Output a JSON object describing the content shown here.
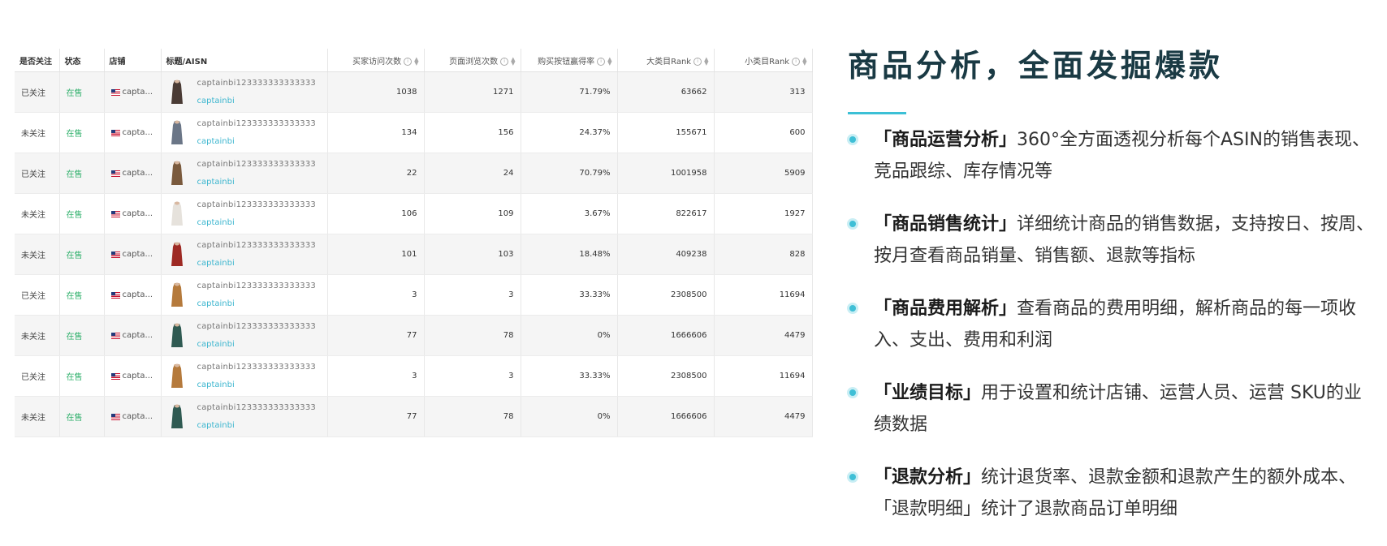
{
  "table": {
    "columns": {
      "follow": "是否关注",
      "status": "状态",
      "store": "店铺",
      "title": "标题/AISN",
      "buyer_visits": "买家访问次数",
      "page_views": "页面浏览次数",
      "buybox_rate": "购买按钮赢得率",
      "main_rank": "大类目Rank",
      "sub_rank": "小类目Rank"
    },
    "rows": [
      {
        "follow": "已关注",
        "status": "在售",
        "store": "capta...",
        "title": "captainbi123333333333333",
        "asin": "captainbi",
        "buyer_visits": "1038",
        "page_views": "1271",
        "buybox_rate": "71.79%",
        "main_rank": "63662",
        "sub_rank": "313",
        "thumb_color": "#4a3b35"
      },
      {
        "follow": "未关注",
        "status": "在售",
        "store": "capta...",
        "title": "captainbi123333333333333",
        "asin": "captainbi",
        "buyer_visits": "134",
        "page_views": "156",
        "buybox_rate": "24.37%",
        "main_rank": "155671",
        "sub_rank": "600",
        "thumb_color": "#6b7687"
      },
      {
        "follow": "已关注",
        "status": "在售",
        "store": "capta...",
        "title": "captainbi123333333333333",
        "asin": "captainbi",
        "buyer_visits": "22",
        "page_views": "24",
        "buybox_rate": "70.79%",
        "main_rank": "1001958",
        "sub_rank": "5909",
        "thumb_color": "#7a5a3d"
      },
      {
        "follow": "未关注",
        "status": "在售",
        "store": "capta...",
        "title": "captainbi123333333333333",
        "asin": "captainbi",
        "buyer_visits": "106",
        "page_views": "109",
        "buybox_rate": "3.67%",
        "main_rank": "822617",
        "sub_rank": "1927",
        "thumb_color": "#e6e2dc"
      },
      {
        "follow": "未关注",
        "status": "在售",
        "store": "capta...",
        "title": "captainbi123333333333333",
        "asin": "captainbi",
        "buyer_visits": "101",
        "page_views": "103",
        "buybox_rate": "18.48%",
        "main_rank": "409238",
        "sub_rank": "828",
        "thumb_color": "#9e2a24"
      },
      {
        "follow": "已关注",
        "status": "在售",
        "store": "capta...",
        "title": "captainbi123333333333333",
        "asin": "captainbi",
        "buyer_visits": "3",
        "page_views": "3",
        "buybox_rate": "33.33%",
        "main_rank": "2308500",
        "sub_rank": "11694",
        "thumb_color": "#b57a3c"
      },
      {
        "follow": "未关注",
        "status": "在售",
        "store": "capta...",
        "title": "captainbi123333333333333",
        "asin": "captainbi",
        "buyer_visits": "77",
        "page_views": "78",
        "buybox_rate": "0%",
        "main_rank": "1666606",
        "sub_rank": "4479",
        "thumb_color": "#2f5a52"
      },
      {
        "follow": "已关注",
        "status": "在售",
        "store": "capta...",
        "title": "captainbi123333333333333",
        "asin": "captainbi",
        "buyer_visits": "3",
        "page_views": "3",
        "buybox_rate": "33.33%",
        "main_rank": "2308500",
        "sub_rank": "11694",
        "thumb_color": "#b57a3c"
      },
      {
        "follow": "未关注",
        "status": "在售",
        "store": "capta...",
        "title": "captainbi123333333333333",
        "asin": "captainbi",
        "buyer_visits": "77",
        "page_views": "78",
        "buybox_rate": "0%",
        "main_rank": "1666606",
        "sub_rank": "4479",
        "thumb_color": "#2f5a52"
      }
    ]
  },
  "panel": {
    "heading": "商品分析，全面发掘爆款",
    "accent_color": "#3cc0d6",
    "features": [
      {
        "name": "「商品运营分析」",
        "desc": "360°全方面透视分析每个ASIN的销售表现、竞品跟综、库存情况等"
      },
      {
        "name": "「商品销售统计」",
        "desc": "详细统计商品的销售数据，支持按日、按周、按月查看商品销量、销售额、退款等指标"
      },
      {
        "name": "「商品费用解析」",
        "desc": "查看商品的费用明细，解析商品的每一项收入、支出、费用和利润"
      },
      {
        "name": "「业绩目标」",
        "desc": "用于设置和统计店铺、运营人员、运营 SKU的业绩数据"
      },
      {
        "name": "「退款分析」",
        "desc": "统计退货率、退款金额和退款产生的额外成本、「退款明细」统计了退款商品订单明细"
      }
    ]
  }
}
